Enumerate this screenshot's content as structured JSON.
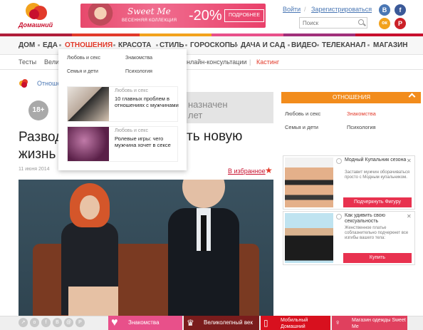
{
  "header": {
    "logo_text": "Домашний",
    "banner": {
      "brand": "Sweet Me",
      "subtitle": "ВЕСЕННЯЯ КОЛЛЕКЦИЯ",
      "discount": "-20%",
      "button": "ПОДРОБНЕЕ"
    },
    "login": "Войти",
    "register": "Зарегистрироваться",
    "search_placeholder": "Поиск",
    "social": [
      "В",
      "f",
      "ок",
      "P"
    ]
  },
  "nav": {
    "items": [
      "ДОМ",
      "ЕДА",
      "ОТНОШЕНИЯ",
      "КРАСОТА",
      "СТИЛЬ",
      "ГОРОСКОПЫ",
      "ДАЧА И САД",
      "ВИДЕО",
      "ТЕЛЕКАНАЛ",
      "МАГАЗИН"
    ],
    "active": "ОТНОШЕНИЯ"
  },
  "subnav": {
    "items": [
      "Тесты",
      "Вели",
      "нлайн-консультации",
      "Кастинг"
    ]
  },
  "dropdown": {
    "links": [
      "Любовь и секс",
      "Знакомства",
      "Семья и дети",
      "Психология"
    ],
    "cards": [
      {
        "category": "Любовь и секс",
        "title": "10 главных проблем в отношениях с мужчинами"
      },
      {
        "category": "Любовь и секс",
        "title": "Ролевые игры: чего мужчина хочет в сексе"
      }
    ]
  },
  "article": {
    "breadcrumb": "Отноше",
    "age_badge": "18+",
    "grey_text_1": "назначен",
    "grey_text_2": "лет",
    "headline_left_1": "Развод",
    "headline_left_2": "жизнь",
    "headline_right": "ть новую",
    "date": "11 июня 2014",
    "favorite": "В избранное"
  },
  "sidebar": {
    "heading": "ОТНОШЕНИЯ",
    "links": [
      "Любовь и секс",
      "Знакомства",
      "Семья и дети",
      "Психология"
    ],
    "ads": [
      {
        "title": "Модный Купальник сезона",
        "desc": "Заставит мужчин оборачиваться просто с Модным купальником.",
        "button": "Подчеркнуть Фигуру"
      },
      {
        "title": "Как удивить свою сексуальность",
        "desc": "Женственное платье соблазнительно подчеркнет все изгибы вашего тела:",
        "button": "Купить"
      }
    ]
  },
  "bottombar": {
    "tabs": [
      {
        "label": "Знакомства",
        "color": "#e8508a"
      },
      {
        "label": "Великолепный век",
        "color": "#7a1c1c"
      },
      {
        "label": "Мобильный Домашний",
        "color": "#d8101e"
      },
      {
        "label": "Магазин одежды Sweet Me",
        "color": "#e0405e"
      }
    ]
  }
}
